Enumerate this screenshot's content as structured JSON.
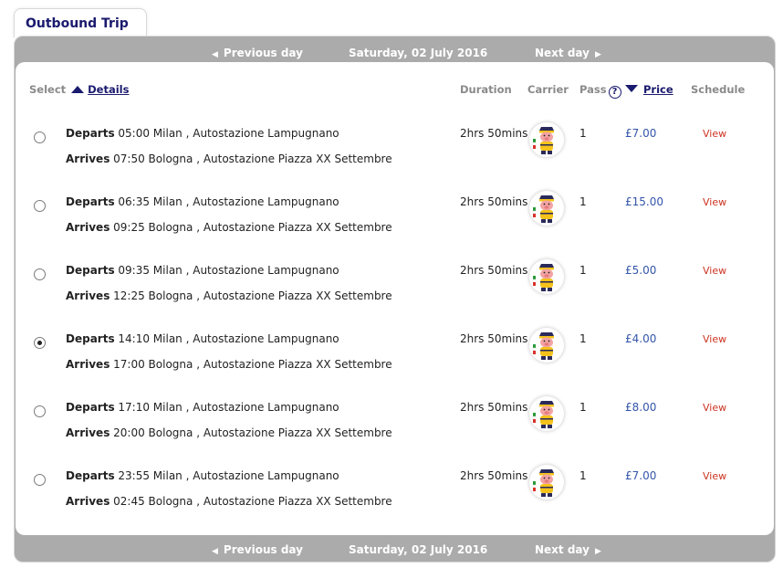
{
  "tab": {
    "title": "Outbound Trip"
  },
  "nav": {
    "previous_label": "Previous day",
    "date_label": "Saturday, 02 July 2016",
    "next_label": "Next day"
  },
  "headers": {
    "select": "Select",
    "details": "Details",
    "duration": "Duration",
    "carrier": "Carrier",
    "pass": "Pass",
    "price": "Price",
    "schedule": "Schedule"
  },
  "rows": [
    {
      "depart_label": "Departs",
      "depart": " 05:00 Milan , Autostazione Lampugnano",
      "arrive_label": "Arrives",
      "arrive": " 07:50 Bologna , Autostazione Piazza XX Settembre",
      "duration": "2hrs 50mins",
      "pass": "1",
      "price": "£7.00",
      "schedule": "View",
      "selected": false
    },
    {
      "depart_label": "Departs",
      "depart": " 06:35 Milan , Autostazione Lampugnano",
      "arrive_label": "Arrives",
      "arrive": " 09:25 Bologna , Autostazione Piazza XX Settembre",
      "duration": "2hrs 50mins",
      "pass": "1",
      "price": "£15.00",
      "schedule": "View",
      "selected": false
    },
    {
      "depart_label": "Departs",
      "depart": " 09:35 Milan , Autostazione Lampugnano",
      "arrive_label": "Arrives",
      "arrive": " 12:25 Bologna , Autostazione Piazza XX Settembre",
      "duration": "2hrs 50mins",
      "pass": "1",
      "price": "£5.00",
      "schedule": "View",
      "selected": false
    },
    {
      "depart_label": "Departs",
      "depart": " 14:10 Milan , Autostazione Lampugnano",
      "arrive_label": "Arrives",
      "arrive": " 17:00 Bologna , Autostazione Piazza XX Settembre",
      "duration": "2hrs 50mins",
      "pass": "1",
      "price": "£4.00",
      "schedule": "View",
      "selected": true
    },
    {
      "depart_label": "Departs",
      "depart": " 17:10 Milan , Autostazione Lampugnano",
      "arrive_label": "Arrives",
      "arrive": " 20:00 Bologna , Autostazione Piazza XX Settembre",
      "duration": "2hrs 50mins",
      "pass": "1",
      "price": "£8.00",
      "schedule": "View",
      "selected": false
    },
    {
      "depart_label": "Departs",
      "depart": " 23:55 Milan , Autostazione Lampugnano",
      "arrive_label": "Arrives",
      "arrive": " 02:45 Bologna , Autostazione Piazza XX Settembre",
      "duration": "2hrs 50mins",
      "pass": "1",
      "price": "£7.00",
      "schedule": "View",
      "selected": false
    }
  ],
  "icons": {
    "carrier": "carrier-mascot-icon",
    "sort_up": "triangle-up-icon",
    "sort_down": "triangle-down-icon",
    "help": "question-mark-icon",
    "prev": "caret-left-icon",
    "next": "caret-right-icon"
  },
  "colors": {
    "header_blue": "#1a1a6e",
    "price_blue": "#3355aa",
    "view_red": "#cc3322",
    "bar_gray": "#ababab"
  }
}
